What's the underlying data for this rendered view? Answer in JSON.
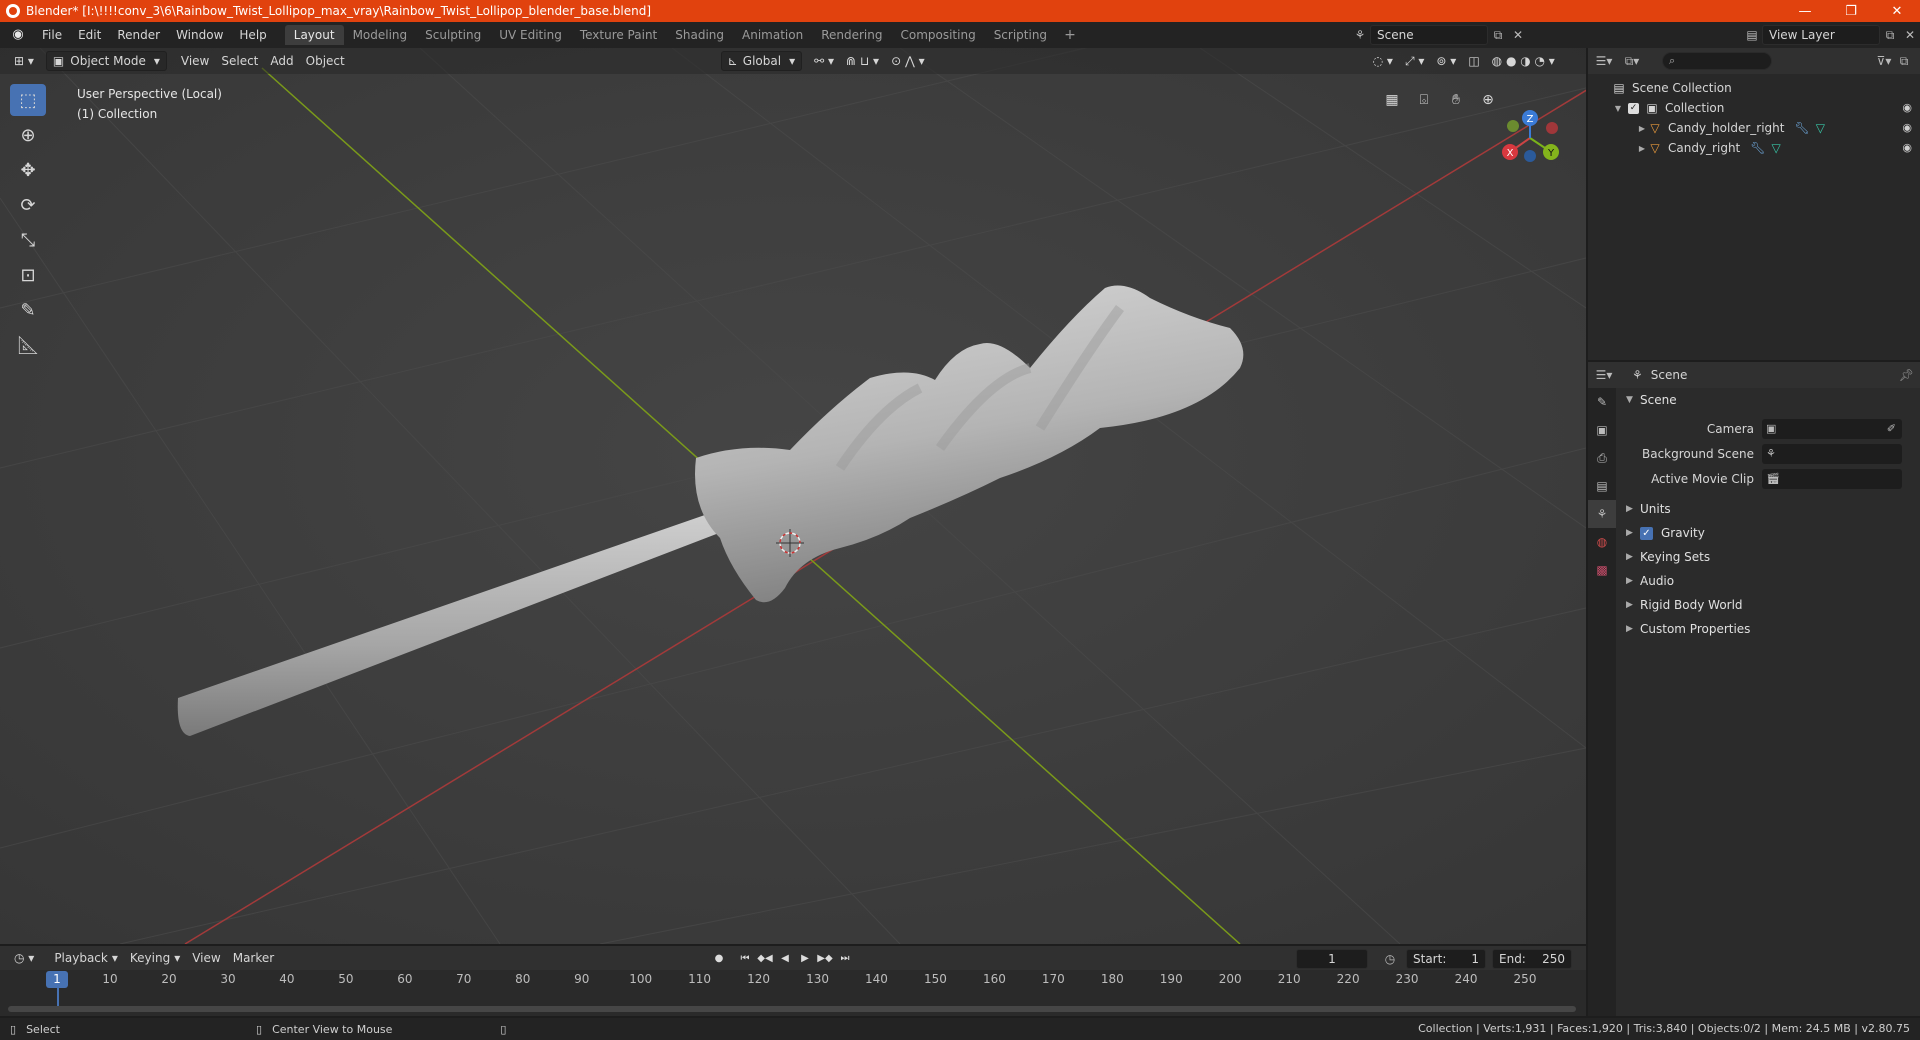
{
  "window": {
    "title": "Blender* [I:\\!!!!conv_3\\6\\Rainbow_Twist_Lollipop_max_vray\\Rainbow_Twist_Lollipop_blender_base.blend]",
    "controls": [
      "—",
      "❐",
      "✕"
    ]
  },
  "menu": [
    "File",
    "Edit",
    "Render",
    "Window",
    "Help"
  ],
  "workspaces": [
    "Layout",
    "Modeling",
    "Sculpting",
    "UV Editing",
    "Texture Paint",
    "Shading",
    "Animation",
    "Rendering",
    "Compositing",
    "Scripting"
  ],
  "workspace_add": "+",
  "scene_selector": {
    "value": "Scene"
  },
  "view_layer_selector": {
    "value": "View Layer"
  },
  "viewport": {
    "mode": "Object Mode",
    "menus": [
      "View",
      "Select",
      "Add",
      "Object"
    ],
    "transform_orientation": "Global",
    "perspective_label": "User Perspective (Local)",
    "collection_label": "(1) Collection",
    "gizmo": {
      "x": "X",
      "y": "Y",
      "z": "Z"
    }
  },
  "outliner": {
    "rows": [
      {
        "name": "Scene Collection"
      },
      {
        "name": "Collection"
      },
      {
        "name": "Candy_holder_right"
      },
      {
        "name": "Candy_right"
      }
    ]
  },
  "properties": {
    "header": "Scene",
    "section": "Scene",
    "fields": [
      {
        "label": "Camera"
      },
      {
        "label": "Background Scene"
      },
      {
        "label": "Active Movie Clip"
      }
    ],
    "panels": [
      "Units",
      "Gravity",
      "Keying Sets",
      "Audio",
      "Rigid Body World",
      "Custom Properties"
    ]
  },
  "timeline": {
    "menus": [
      "Playback",
      "Keying",
      "View",
      "Marker"
    ],
    "current_frame": "1",
    "start_label": "Start:",
    "start": "1",
    "end_label": "End:",
    "end": "250",
    "ruler": [
      "1",
      "10",
      "20",
      "30",
      "40",
      "50",
      "60",
      "70",
      "80",
      "90",
      "100",
      "110",
      "120",
      "130",
      "140",
      "150",
      "160",
      "170",
      "180",
      "190",
      "200",
      "210",
      "220",
      "230",
      "240",
      "250"
    ]
  },
  "statusbar": {
    "left_action": "Select",
    "middle_action": "Center View to Mouse",
    "stats": "Collection | Verts:1,931 | Faces:1,920 | Tris:3,840 | Objects:0/2 | Mem: 24.5 MB | v2.80.75"
  }
}
